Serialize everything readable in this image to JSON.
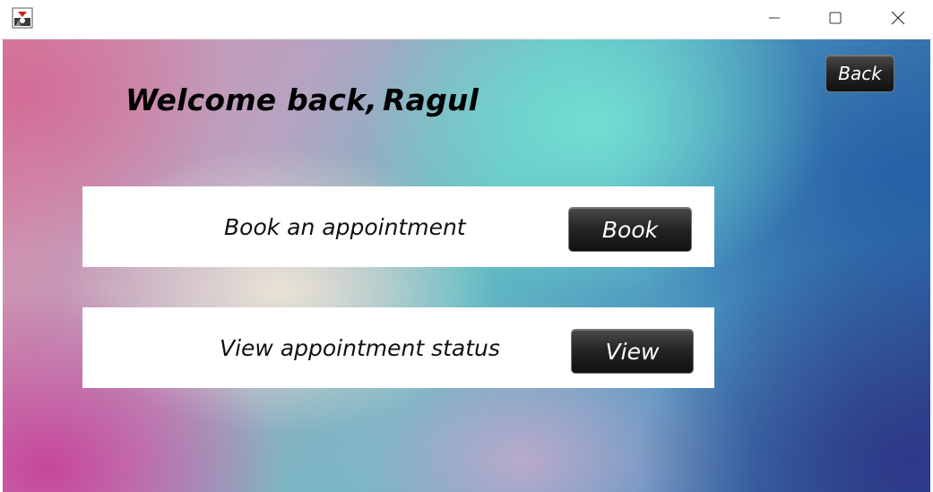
{
  "titlebar": {
    "app_icon": "java-duke-icon",
    "controls": {
      "minimize_icon": "minimize-icon",
      "maximize_icon": "maximize-icon",
      "close_icon": "close-icon"
    }
  },
  "header": {
    "welcome_text": "Welcome back,",
    "user_name": "Ragul",
    "back_label": "Back"
  },
  "cards": [
    {
      "label": "Book an appointment",
      "button_label": "Book"
    },
    {
      "label": "View appointment status",
      "button_label": "View"
    }
  ],
  "colors": {
    "button_bg": "#262626",
    "button_text": "#ffffff",
    "card_bg": "#ffffff",
    "heading_text": "#000000"
  }
}
